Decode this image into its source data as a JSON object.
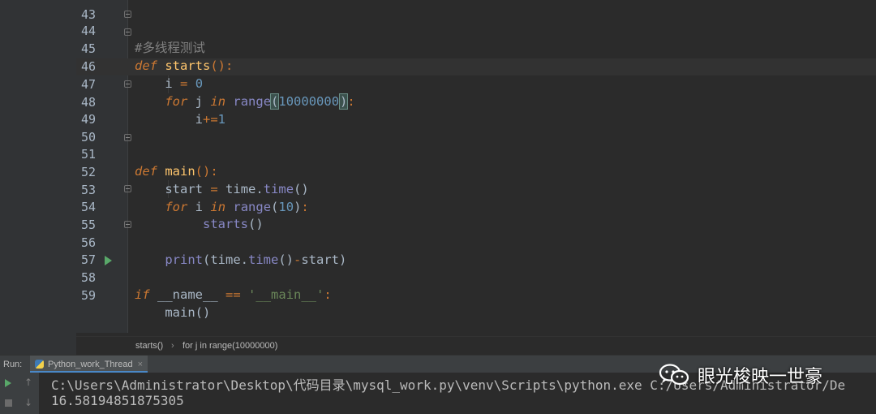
{
  "editor": {
    "partial_top_line": "43",
    "lines": [
      {
        "num": "44",
        "comment": "#多线程测试"
      },
      {
        "num": "45",
        "kw": "def",
        "fn": "starts",
        "rest": "():"
      },
      {
        "num": "46",
        "var": "i",
        "op": "=",
        "val": "0"
      },
      {
        "num": "47",
        "kw": "for",
        "var": "j",
        "kw2": "in",
        "bi": "range",
        "open": "(",
        "val": "10000000",
        "close": ")",
        "colon": ":"
      },
      {
        "num": "48",
        "var": "i",
        "op": "+=",
        "val": "1"
      },
      {
        "num": "49"
      },
      {
        "num": "50"
      },
      {
        "num": "51",
        "kw": "def",
        "fn": "main",
        "rest": "():"
      },
      {
        "num": "52",
        "var": "start",
        "op": "=",
        "obj": "time",
        "dot": ".",
        "method": "time",
        "call": "()"
      },
      {
        "num": "53",
        "kw": "for",
        "var": "i",
        "kw2": "in",
        "bi": "range",
        "open": "(",
        "val": "10",
        "close": ")",
        "colon": ":"
      },
      {
        "num": "54",
        "call_name": "starts",
        "call": "()"
      },
      {
        "num": "55"
      },
      {
        "num": "56",
        "bi": "print",
        "text1": "(time.",
        "method": "time",
        "text2": "()",
        "op": "-",
        "text3": "start)"
      },
      {
        "num": "57"
      },
      {
        "num": "58",
        "kw": "if",
        "dunder": "__name__",
        "op": "==",
        "str": "'__main__'",
        "colon": ":"
      },
      {
        "num": "59",
        "call_name": "main",
        "call": "()"
      }
    ]
  },
  "breadcrumb": {
    "items": [
      "starts()",
      "for j in range(10000000)"
    ],
    "separator": "›"
  },
  "run_panel": {
    "label": "Run:",
    "tab_name": "Python_work_Thread",
    "close_glyph": "×",
    "console_lines": [
      "C:\\Users\\Administrator\\Desktop\\代码目录\\mysql_work.py\\venv\\Scripts\\python.exe C:/Users/Administrator/De",
      "16.58194851875305"
    ]
  },
  "watermark": {
    "text": "眼光梭映一世豪"
  },
  "colors": {
    "background": "#2b2b2b",
    "gutter": "#313335",
    "keyword": "#cc7832",
    "function": "#ffc66d",
    "number": "#6897bb",
    "string": "#6a8759",
    "builtin": "#8888c6",
    "comment": "#808080",
    "run_green": "#59a869"
  }
}
